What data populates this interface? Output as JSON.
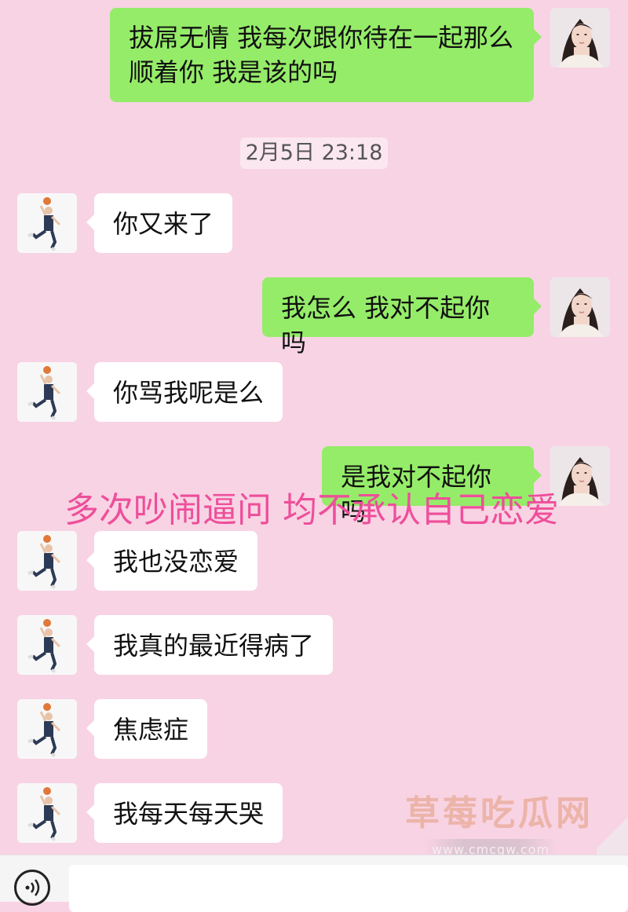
{
  "messages": [
    {
      "side": "out",
      "text_lines": [
        "拔屌无情 我每次跟你待在一起那么",
        "顺着你 我是该的吗"
      ]
    },
    {
      "side": "in",
      "text": "你又来了"
    },
    {
      "side": "out",
      "text": "我怎么 我对不起你吗"
    },
    {
      "side": "in",
      "text": "你骂我呢是么"
    },
    {
      "side": "out",
      "text": "是我对不起你吗"
    },
    {
      "side": "in",
      "text": "我也没恋爱"
    },
    {
      "side": "in",
      "text": "我真的最近得病了"
    },
    {
      "side": "in",
      "text": "焦虑症"
    },
    {
      "side": "in",
      "text": "我每天每天哭"
    }
  ],
  "timestamp": "2月5日 23:18",
  "overlay_caption": "多次吵闹逼问 均不承认自己恋爱",
  "watermark": {
    "title": "草莓吃瓜网",
    "url": "www.cmcgw.com"
  },
  "icons": {
    "left_avatar": "basketball-player-avatar-icon",
    "right_avatar": "woman-portrait-avatar-icon",
    "voice": "voice-input-icon"
  },
  "colors": {
    "background": "#f8d3e4",
    "outgoing_bubble": "#95ec69",
    "incoming_bubble": "#ffffff",
    "caption": "#ee4e9a"
  }
}
